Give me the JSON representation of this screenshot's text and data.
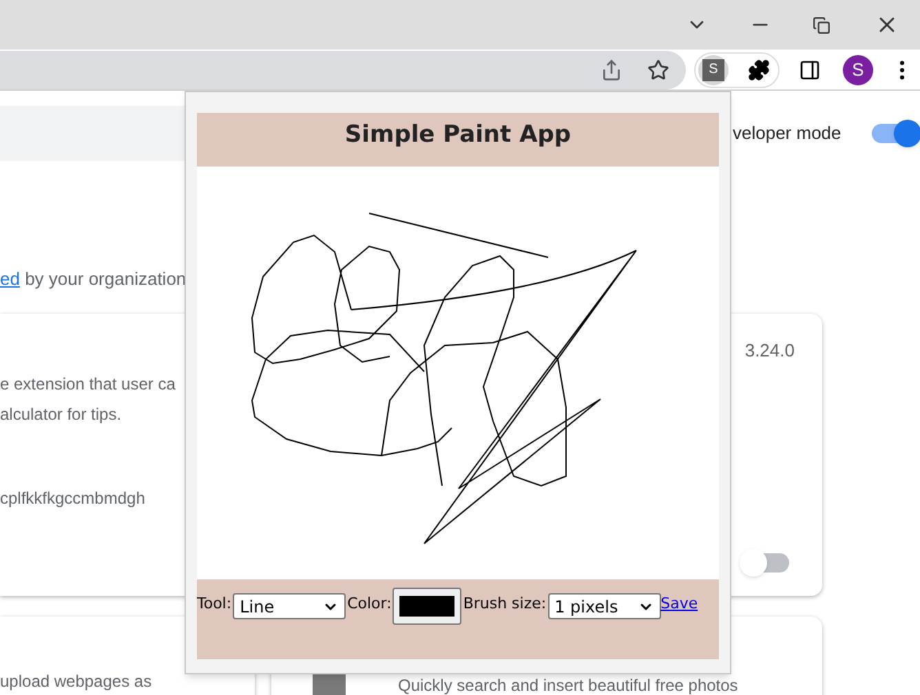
{
  "profile": {
    "letter": "S"
  },
  "extension_button": {
    "letter": "S"
  },
  "developer_mode": {
    "label": "veloper mode",
    "on": true
  },
  "notice": {
    "link": "ed",
    "text": " by your organization"
  },
  "cards": [
    {
      "description": [
        "e extension that user ca",
        "alculator for tips."
      ],
      "id": "cplfkkfkgccmbmdgh"
    },
    {
      "version": "3.24.0",
      "enabled": false
    },
    {
      "description": [
        "upload webpages as"
      ]
    },
    {
      "description": [
        "Quickly search and insert beautiful free photos"
      ]
    }
  ],
  "popup": {
    "title": "Simple Paint App",
    "tool": {
      "label": "Tool:",
      "value": "Line"
    },
    "color": {
      "label": "Color:",
      "color": "#000000"
    },
    "brush": {
      "label": "Brush size:",
      "value": "1 pixels"
    },
    "save": "Save"
  }
}
